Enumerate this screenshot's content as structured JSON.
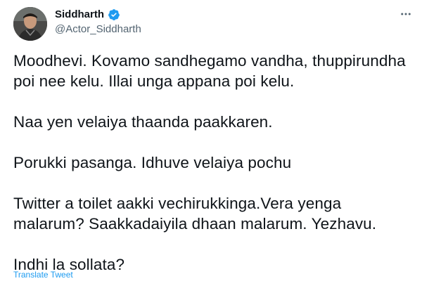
{
  "author": {
    "name": "Siddharth",
    "handle": "@Actor_Siddharth",
    "verified": true,
    "verified_color": "#1d9bf0"
  },
  "tweet": {
    "paragraphs": [
      "Moodhevi. Kovamo sandhegamo vandha, thuppirundha poi nee kelu. Illai unga appana poi kelu.",
      "Naa yen velaiya thaanda paakkaren.",
      "Porukki pasanga. Idhuve velaiya pochu",
      "Twitter a toilet aakki vechirukkinga.Vera yenga malarum? Saakkadaiyila dhaan malarum. Yezhavu.",
      "Indhi la sollata?"
    ],
    "translate_label": "Translate Tweet"
  },
  "icons": {
    "verified": "verified-badge-icon",
    "more": "more-options-icon"
  },
  "colors": {
    "text": "#0f1419",
    "secondary": "#536471",
    "link": "#1d9bf0"
  }
}
